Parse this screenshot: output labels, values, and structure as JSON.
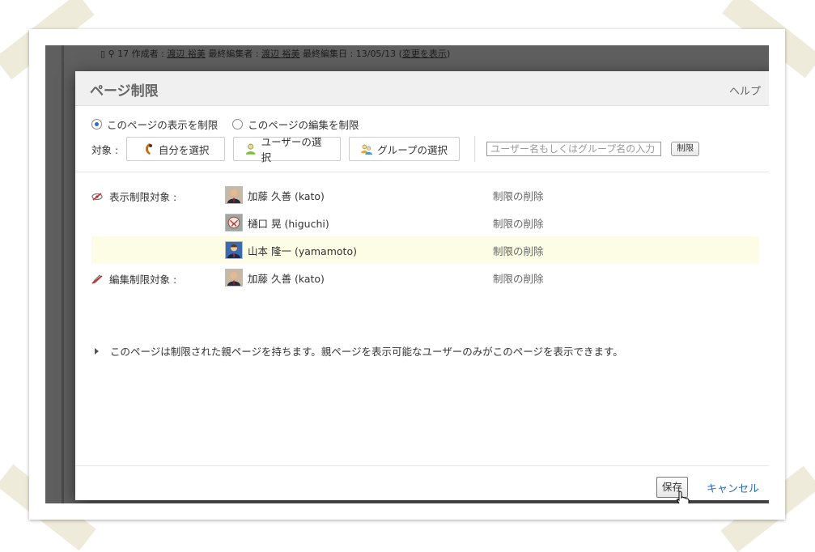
{
  "background": {
    "meta_count": "17",
    "meta_author_label": "作成者 :",
    "meta_author": "渡辺 裕美",
    "meta_editor_label": "最終編集者 :",
    "meta_editor": "渡辺 裕美",
    "meta_date_label": "最終編集日 :",
    "meta_date": "13/05/13",
    "meta_changes_open": "(",
    "meta_changes": "変更を表示",
    "meta_changes_close": ")"
  },
  "dialog": {
    "title": "ページ制限",
    "help": "ヘルプ",
    "options": {
      "view_label": "このページの表示を制限",
      "edit_label": "このページの編集を制限",
      "selected": "view"
    },
    "target": {
      "label": "対象 :",
      "self_button": "自分を選択",
      "user_button": "ユーザーの選択",
      "group_button": "グループの選択",
      "search_placeholder": "ユーザー名もしくはグループ名の入力",
      "restrict_button": "制限"
    },
    "restrictions": [
      {
        "category": "表示制限対象 :",
        "category_icon": "view-restriction-icon",
        "user": "加藤 久善 (kato)",
        "remove": "制限の削除"
      },
      {
        "category": "",
        "user": "樋口 晃 (higuchi)",
        "remove": "制限の削除"
      },
      {
        "category": "",
        "user": "山本 隆一 (yamamoto)",
        "remove": "制限の削除"
      },
      {
        "category": "編集制限対象 :",
        "category_icon": "edit-restriction-icon",
        "user": "加藤 久善 (kato)",
        "remove": "制限の削除"
      }
    ],
    "note": "このページは制限された親ページを持ちます。親ページを表示可能なユーザーのみがこのページを表示できます。",
    "footer": {
      "save": "保存",
      "cancel": "キャンセル"
    }
  },
  "colors": {
    "accent": "#2b6bb3",
    "highlight_row": "#fdfde6",
    "header_bg": "#f0f0f0"
  }
}
